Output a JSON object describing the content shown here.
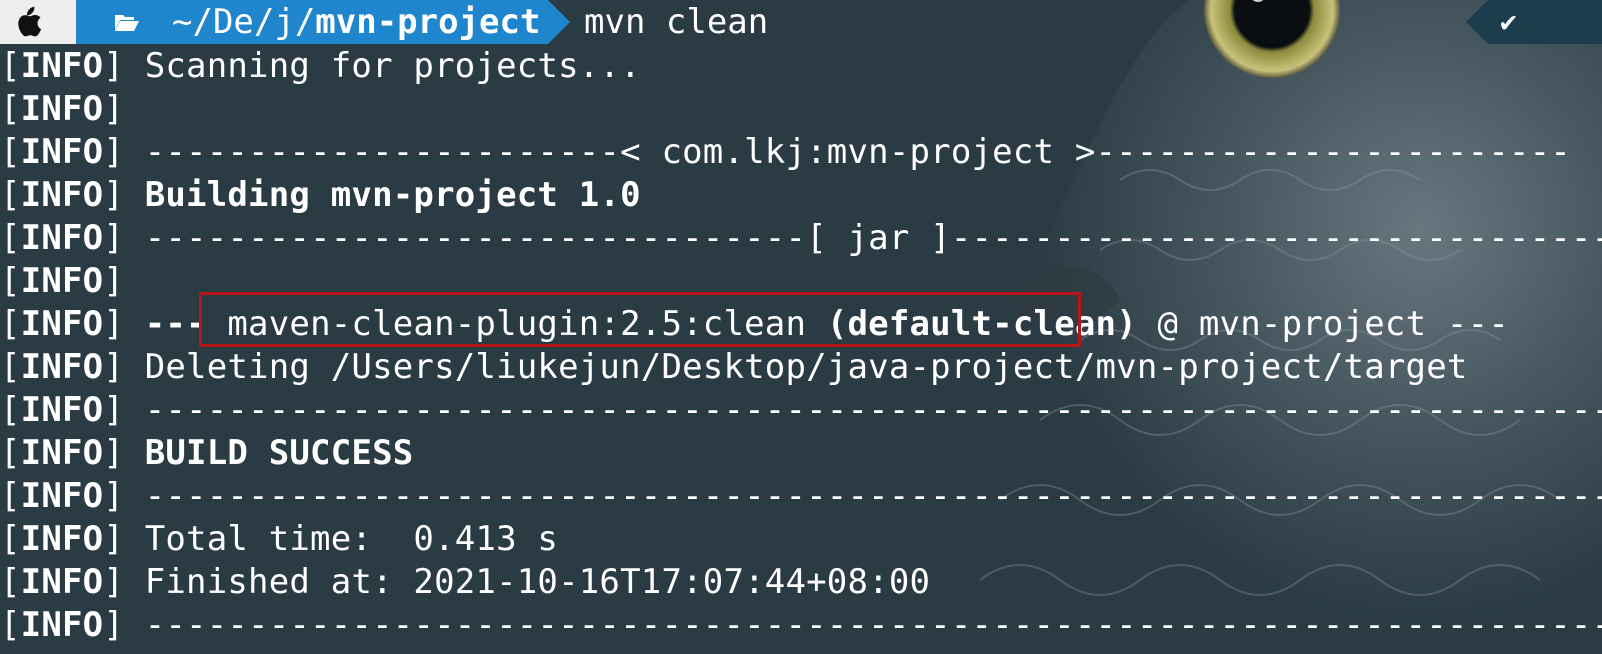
{
  "prompt": {
    "apple_icon": "apple-icon",
    "folder_icon": "folder-icon",
    "path_prefix": "~/De/j/",
    "path_current": "mvn-project",
    "command": "mvn clean",
    "status_icon": "check-icon",
    "status_symbol": "✔"
  },
  "log": [
    {
      "tag": "INFO",
      "text": "Scanning for projects..."
    },
    {
      "tag": "INFO",
      "text": ""
    },
    {
      "tag": "INFO",
      "text": "-----------------------< com.lkj:mvn-project >-----------------------"
    },
    {
      "tag": "INFO",
      "text": "Building mvn-project 1.0"
    },
    {
      "tag": "INFO",
      "text": "--------------------------------[ jar ]---------------------------------"
    },
    {
      "tag": "INFO",
      "text": ""
    },
    {
      "tag": "INFO",
      "prefix": "--- ",
      "plugin": "maven-clean-plugin:2.5:clean",
      "execution": "(default-clean)",
      "suffix": " @ mvn-project ---"
    },
    {
      "tag": "INFO",
      "text": "Deleting /Users/liukejun/Desktop/java-project/mvn-project/target"
    },
    {
      "tag": "INFO",
      "text": "------------------------------------------------------------------------"
    },
    {
      "tag": "INFO",
      "text": "BUILD SUCCESS"
    },
    {
      "tag": "INFO",
      "text": "------------------------------------------------------------------------"
    },
    {
      "tag": "INFO",
      "text": "Total time:  0.413 s"
    },
    {
      "tag": "INFO",
      "text": "Finished at: 2021-10-16T17:07:44+08:00"
    },
    {
      "tag": "INFO",
      "text": "------------------------------------------------------------------------"
    }
  ],
  "colors": {
    "background": "#2a3b44",
    "prompt_dir_bg": "#1f85cc",
    "prompt_apple_bg": "#eeeeee",
    "highlight_border": "#b5161b",
    "status_bg": "#1b3d4d"
  }
}
